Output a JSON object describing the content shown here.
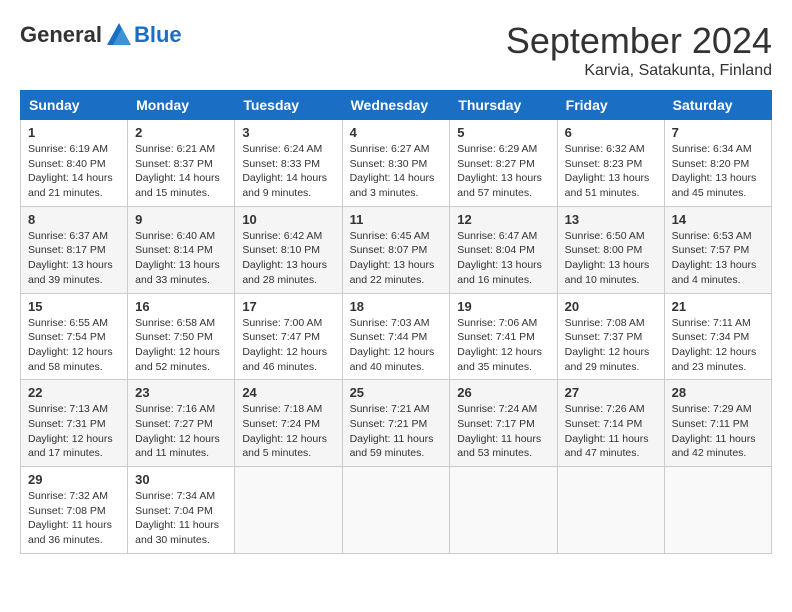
{
  "header": {
    "logo_general": "General",
    "logo_blue": "Blue",
    "month_title": "September 2024",
    "location": "Karvia, Satakunta, Finland"
  },
  "days_of_week": [
    "Sunday",
    "Monday",
    "Tuesday",
    "Wednesday",
    "Thursday",
    "Friday",
    "Saturday"
  ],
  "weeks": [
    [
      {
        "day": "1",
        "sunrise": "Sunrise: 6:19 AM",
        "sunset": "Sunset: 8:40 PM",
        "daylight": "Daylight: 14 hours and 21 minutes."
      },
      {
        "day": "2",
        "sunrise": "Sunrise: 6:21 AM",
        "sunset": "Sunset: 8:37 PM",
        "daylight": "Daylight: 14 hours and 15 minutes."
      },
      {
        "day": "3",
        "sunrise": "Sunrise: 6:24 AM",
        "sunset": "Sunset: 8:33 PM",
        "daylight": "Daylight: 14 hours and 9 minutes."
      },
      {
        "day": "4",
        "sunrise": "Sunrise: 6:27 AM",
        "sunset": "Sunset: 8:30 PM",
        "daylight": "Daylight: 14 hours and 3 minutes."
      },
      {
        "day": "5",
        "sunrise": "Sunrise: 6:29 AM",
        "sunset": "Sunset: 8:27 PM",
        "daylight": "Daylight: 13 hours and 57 minutes."
      },
      {
        "day": "6",
        "sunrise": "Sunrise: 6:32 AM",
        "sunset": "Sunset: 8:23 PM",
        "daylight": "Daylight: 13 hours and 51 minutes."
      },
      {
        "day": "7",
        "sunrise": "Sunrise: 6:34 AM",
        "sunset": "Sunset: 8:20 PM",
        "daylight": "Daylight: 13 hours and 45 minutes."
      }
    ],
    [
      {
        "day": "8",
        "sunrise": "Sunrise: 6:37 AM",
        "sunset": "Sunset: 8:17 PM",
        "daylight": "Daylight: 13 hours and 39 minutes."
      },
      {
        "day": "9",
        "sunrise": "Sunrise: 6:40 AM",
        "sunset": "Sunset: 8:14 PM",
        "daylight": "Daylight: 13 hours and 33 minutes."
      },
      {
        "day": "10",
        "sunrise": "Sunrise: 6:42 AM",
        "sunset": "Sunset: 8:10 PM",
        "daylight": "Daylight: 13 hours and 28 minutes."
      },
      {
        "day": "11",
        "sunrise": "Sunrise: 6:45 AM",
        "sunset": "Sunset: 8:07 PM",
        "daylight": "Daylight: 13 hours and 22 minutes."
      },
      {
        "day": "12",
        "sunrise": "Sunrise: 6:47 AM",
        "sunset": "Sunset: 8:04 PM",
        "daylight": "Daylight: 13 hours and 16 minutes."
      },
      {
        "day": "13",
        "sunrise": "Sunrise: 6:50 AM",
        "sunset": "Sunset: 8:00 PM",
        "daylight": "Daylight: 13 hours and 10 minutes."
      },
      {
        "day": "14",
        "sunrise": "Sunrise: 6:53 AM",
        "sunset": "Sunset: 7:57 PM",
        "daylight": "Daylight: 13 hours and 4 minutes."
      }
    ],
    [
      {
        "day": "15",
        "sunrise": "Sunrise: 6:55 AM",
        "sunset": "Sunset: 7:54 PM",
        "daylight": "Daylight: 12 hours and 58 minutes."
      },
      {
        "day": "16",
        "sunrise": "Sunrise: 6:58 AM",
        "sunset": "Sunset: 7:50 PM",
        "daylight": "Daylight: 12 hours and 52 minutes."
      },
      {
        "day": "17",
        "sunrise": "Sunrise: 7:00 AM",
        "sunset": "Sunset: 7:47 PM",
        "daylight": "Daylight: 12 hours and 46 minutes."
      },
      {
        "day": "18",
        "sunrise": "Sunrise: 7:03 AM",
        "sunset": "Sunset: 7:44 PM",
        "daylight": "Daylight: 12 hours and 40 minutes."
      },
      {
        "day": "19",
        "sunrise": "Sunrise: 7:06 AM",
        "sunset": "Sunset: 7:41 PM",
        "daylight": "Daylight: 12 hours and 35 minutes."
      },
      {
        "day": "20",
        "sunrise": "Sunrise: 7:08 AM",
        "sunset": "Sunset: 7:37 PM",
        "daylight": "Daylight: 12 hours and 29 minutes."
      },
      {
        "day": "21",
        "sunrise": "Sunrise: 7:11 AM",
        "sunset": "Sunset: 7:34 PM",
        "daylight": "Daylight: 12 hours and 23 minutes."
      }
    ],
    [
      {
        "day": "22",
        "sunrise": "Sunrise: 7:13 AM",
        "sunset": "Sunset: 7:31 PM",
        "daylight": "Daylight: 12 hours and 17 minutes."
      },
      {
        "day": "23",
        "sunrise": "Sunrise: 7:16 AM",
        "sunset": "Sunset: 7:27 PM",
        "daylight": "Daylight: 12 hours and 11 minutes."
      },
      {
        "day": "24",
        "sunrise": "Sunrise: 7:18 AM",
        "sunset": "Sunset: 7:24 PM",
        "daylight": "Daylight: 12 hours and 5 minutes."
      },
      {
        "day": "25",
        "sunrise": "Sunrise: 7:21 AM",
        "sunset": "Sunset: 7:21 PM",
        "daylight": "Daylight: 11 hours and 59 minutes."
      },
      {
        "day": "26",
        "sunrise": "Sunrise: 7:24 AM",
        "sunset": "Sunset: 7:17 PM",
        "daylight": "Daylight: 11 hours and 53 minutes."
      },
      {
        "day": "27",
        "sunrise": "Sunrise: 7:26 AM",
        "sunset": "Sunset: 7:14 PM",
        "daylight": "Daylight: 11 hours and 47 minutes."
      },
      {
        "day": "28",
        "sunrise": "Sunrise: 7:29 AM",
        "sunset": "Sunset: 7:11 PM",
        "daylight": "Daylight: 11 hours and 42 minutes."
      }
    ],
    [
      {
        "day": "29",
        "sunrise": "Sunrise: 7:32 AM",
        "sunset": "Sunset: 7:08 PM",
        "daylight": "Daylight: 11 hours and 36 minutes."
      },
      {
        "day": "30",
        "sunrise": "Sunrise: 7:34 AM",
        "sunset": "Sunset: 7:04 PM",
        "daylight": "Daylight: 11 hours and 30 minutes."
      },
      null,
      null,
      null,
      null,
      null
    ]
  ]
}
